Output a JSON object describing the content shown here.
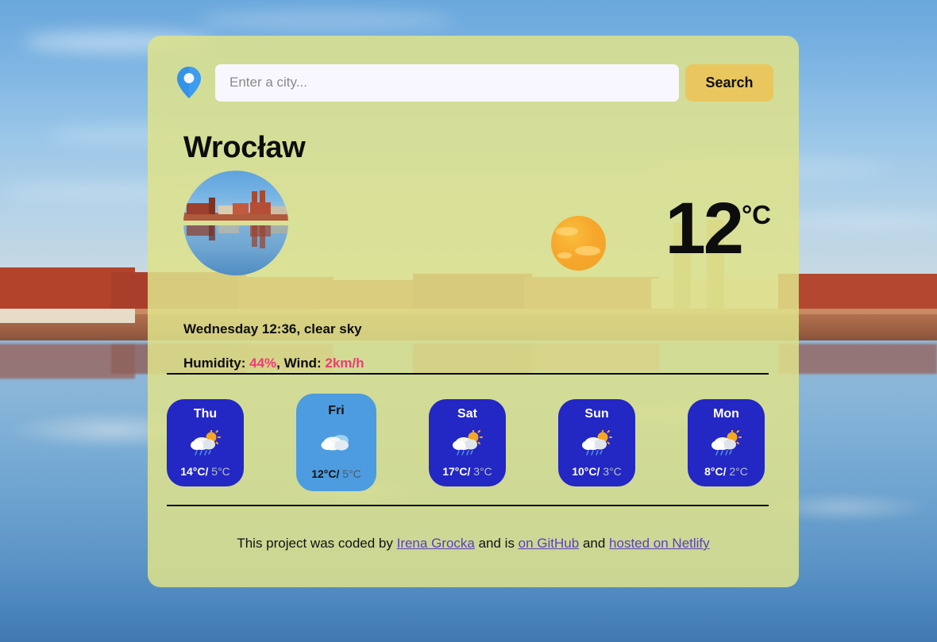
{
  "search": {
    "pin_icon": "location-pin-icon",
    "placeholder": "Enter a city...",
    "value": "",
    "button_label": "Search"
  },
  "current": {
    "city": "Wrocław",
    "city_photo_alt": "Wrocław Ostrów Tumski skyline reflected in the Oder river",
    "weather_icon": "sun-icon",
    "temperature": "12",
    "unit": "°C",
    "conditions": "Wednesday 12:36, clear sky",
    "metrics": {
      "humidity_label": "Humidity: ",
      "humidity_value": "44%",
      "wind_label": ", Wind: ",
      "wind_value": "2km/h"
    }
  },
  "forecast": [
    {
      "day": "Thu",
      "icon": "sun-behind-rain-cloud-icon",
      "max": "14°C/",
      "min": " 5°C",
      "active": false
    },
    {
      "day": "Fri",
      "icon": "cloud-icon",
      "max": "12°C/",
      "min": " 5°C",
      "active": true
    },
    {
      "day": "Sat",
      "icon": "sun-behind-rain-cloud-icon",
      "max": "17°C/",
      "min": " 3°C",
      "active": false
    },
    {
      "day": "Sun",
      "icon": "sun-behind-rain-cloud-icon",
      "max": "10°C/",
      "min": " 3°C",
      "active": false
    },
    {
      "day": "Mon",
      "icon": "sun-behind-rain-cloud-icon",
      "max": "8°C/",
      "min": " 2°C",
      "active": false
    }
  ],
  "footer": {
    "intro": "This project was coded by ",
    "author_link": "Irena Grocka",
    "mid": " and is ",
    "github_link": "on GitHub",
    "and": " and ",
    "netlify_link": "hosted on Netlify"
  },
  "colors": {
    "card_overlay": "#dee28a",
    "search_button": "#e9c75e",
    "forecast_card": "#2327c4",
    "forecast_card_active": "#4d9ce0",
    "metric_accent": "#ec3e74",
    "link": "#5b3fbe",
    "pin": "#3d9cf0"
  }
}
